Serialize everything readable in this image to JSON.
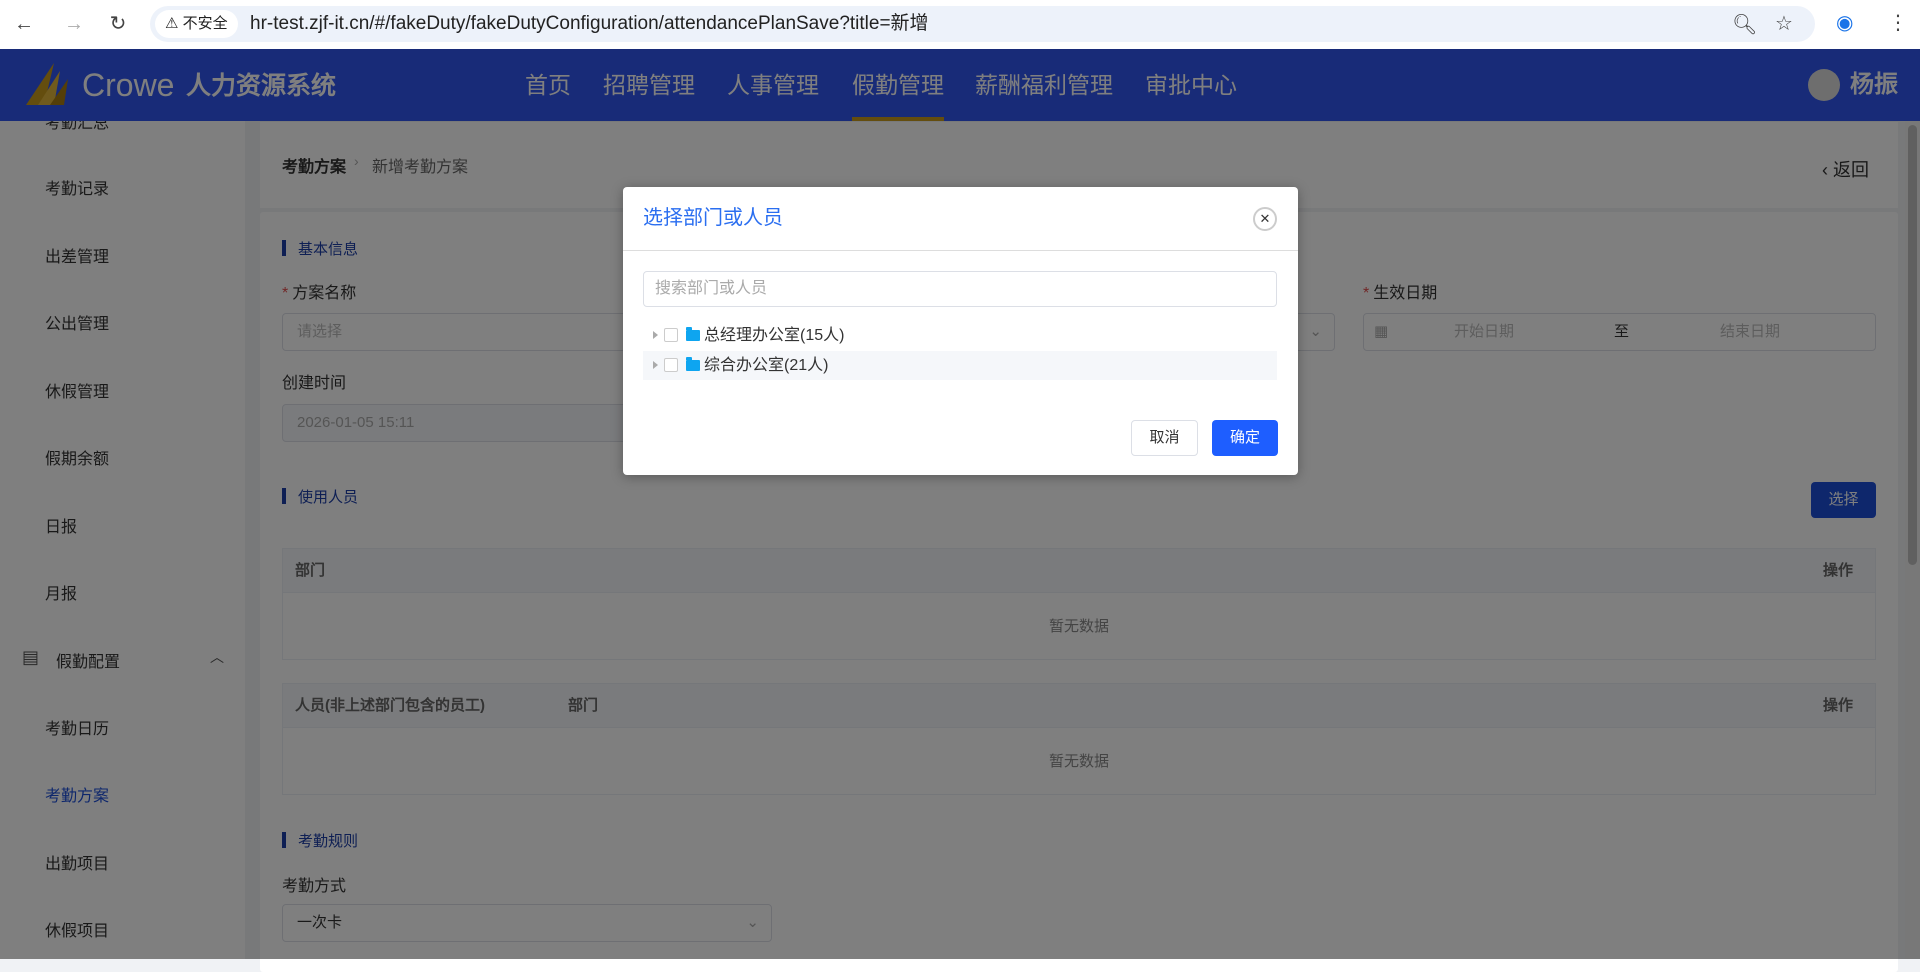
{
  "browser": {
    "security_label": "不安全",
    "url": "hr-test.zjf-it.cn/#/fakeDuty/fakeDutyConfiguration/attendancePlanSave?title=新增"
  },
  "header": {
    "brand": "Crowe",
    "system_name": "人力资源系统",
    "nav": [
      "首页",
      "招聘管理",
      "人事管理",
      "假勤管理",
      "薪酬福利管理",
      "审批中心"
    ],
    "active_nav": "假勤管理",
    "user_name": "杨振"
  },
  "sidebar": {
    "items": [
      "考勤汇总",
      "考勤记录",
      "出差管理",
      "公出管理",
      "休假管理",
      "假期余额",
      "日报",
      "月报"
    ],
    "group": "假勤配置",
    "group_items": [
      "考勤日历",
      "考勤方案",
      "出勤项目",
      "休假项目"
    ]
  },
  "breadcrumb": {
    "parent": "考勤方案",
    "current": "新增考勤方案",
    "back": "返回"
  },
  "form": {
    "basic_section": "基本信息",
    "plan_name_label": "方案名称",
    "plan_name_placeholder": "请选择",
    "effective_label": "生效日期",
    "start_placeholder": "开始日期",
    "range_sep": "至",
    "end_placeholder": "结束日期",
    "created_label": "创建时间",
    "created_value": "2026-01-05 15:11",
    "users_section": "使用人员",
    "select_button": "选择",
    "dept_table": {
      "headers": [
        "部门",
        "操作"
      ],
      "empty": "暂无数据"
    },
    "person_table": {
      "headers": [
        "人员(非上述部门包含的员工)",
        "部门",
        "操作"
      ],
      "empty": "暂无数据"
    },
    "rules_section": "考勤规则",
    "mode_label": "考勤方式",
    "mode_value": "一次卡"
  },
  "modal": {
    "title": "选择部门或人员",
    "search_placeholder": "搜索部门或人员",
    "tree": [
      {
        "label": "总经理办公室(15人)",
        "checked": false
      },
      {
        "label": "综合办公室(21人)",
        "checked": false
      }
    ],
    "cancel": "取消",
    "confirm": "确定"
  }
}
